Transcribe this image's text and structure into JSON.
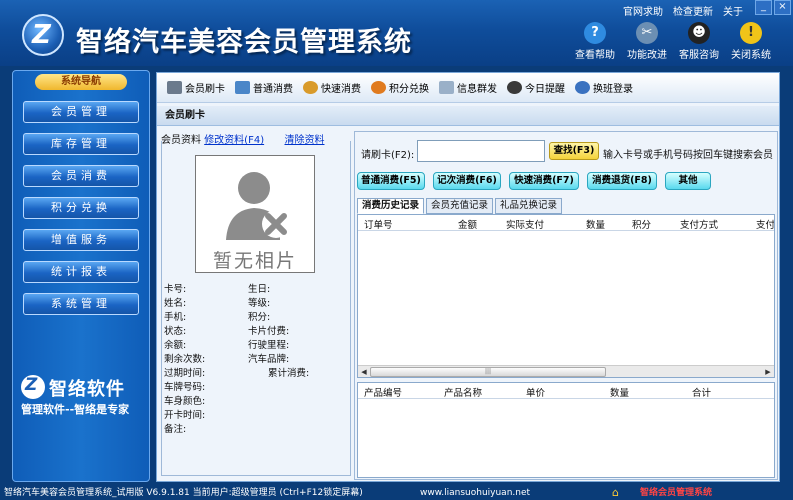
{
  "header": {
    "app_title": "智络汽车美容会员管理系统",
    "top_links": [
      "官网求助",
      "检查更新",
      "关于"
    ],
    "window_controls": [
      "_",
      "×"
    ],
    "buttons": [
      {
        "label": "查看帮助",
        "icon": "help-icon",
        "color": "#2f8be0"
      },
      {
        "label": "功能改进",
        "icon": "tools-icon",
        "color": "#6c8fb3"
      },
      {
        "label": "客服咨询",
        "icon": "qq-icon",
        "color": "#222222"
      },
      {
        "label": "关闭系统",
        "icon": "warning-icon",
        "color": "#f0c419"
      }
    ]
  },
  "sidebar": {
    "heading": "系统导航",
    "items": [
      "会员管理",
      "库存管理",
      "会员消费",
      "积分兑换",
      "增值服务",
      "统计报表",
      "系统管理"
    ],
    "brand_name": "智络软件",
    "brand_slogan": "管理软件--智络是专家"
  },
  "toolbar": {
    "items": [
      {
        "label": "会员刷卡",
        "icon": "card-icon",
        "color": "#6b7a8c"
      },
      {
        "label": "普通消费",
        "icon": "document-icon",
        "color": "#4a86c8"
      },
      {
        "label": "快速消费",
        "icon": "money-bag-icon",
        "color": "#d99b2b"
      },
      {
        "label": "积分兑换",
        "icon": "exchange-icon",
        "color": "#e07b1f"
      },
      {
        "label": "信息群发",
        "icon": "envelope-icon",
        "color": "#9ab0c8"
      },
      {
        "label": "今日提醒",
        "icon": "clock-icon",
        "color": "#3a3a3a"
      },
      {
        "label": "换班登录",
        "icon": "login-icon",
        "color": "#3a72c0"
      }
    ]
  },
  "section_title": "会员刷卡",
  "member": {
    "tab_label": "会员资料",
    "edit_link": "修改资料(F4)",
    "clear_link": "清除资料",
    "photo_placeholder": "暂无相片",
    "fields_left": [
      "卡号:",
      "姓名:",
      "手机:",
      "状态:",
      "余额:",
      "剩余次数:",
      "过期时间:",
      "车牌号码:",
      "车身颜色:",
      "开卡时间:",
      "备注:"
    ],
    "fields_right": [
      "生日:",
      "等级:",
      "积分:",
      "卡片付费:",
      "行驶里程:",
      "汽车品牌:",
      "累计消费:"
    ]
  },
  "work": {
    "swipe_label": "请刷卡(F2):",
    "swipe_value": "",
    "search_button": "查找(F3)",
    "hint": "输入卡号或手机号码按回车键搜索会员",
    "action_buttons": [
      "普通消费(F5)",
      "记次消费(F6)",
      "快速消费(F7)",
      "消费退货(F8)",
      "其他"
    ],
    "record_tabs": [
      "消费历史记录",
      "会员充值记录",
      "礼品兑换记录"
    ],
    "history_columns": [
      "订单号",
      "金额",
      "实际支付",
      "数量",
      "积分",
      "支付方式",
      "支付"
    ],
    "product_columns": [
      "产品编号",
      "产品名称",
      "单价",
      "数量",
      "合计"
    ]
  },
  "statusbar": {
    "version": "智络汽车美容会员管理系统_试用版 V6.9.1.81",
    "user": "当前用户:超级管理员 (Ctrl+F12锁定屏幕)",
    "website": "www.liansuohuiyuan.net",
    "footer_brand": "智络会员管理系统"
  }
}
